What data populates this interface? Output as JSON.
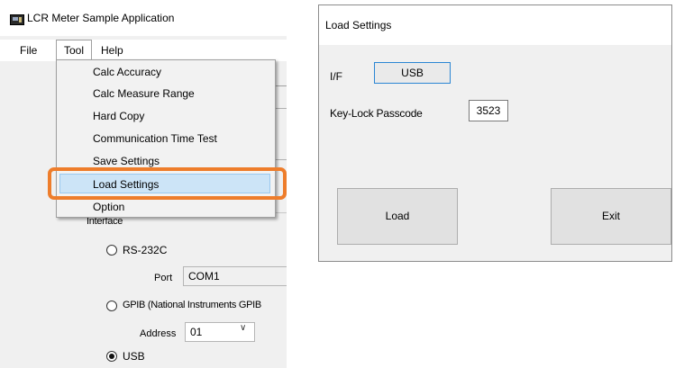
{
  "left_window": {
    "title": "LCR Meter Sample Application",
    "menu": {
      "file": "File",
      "tool": "Tool",
      "help": "Help"
    },
    "tool_menu_items": [
      "Calc Accuracy",
      "Calc Measure Range",
      "Hard Copy",
      "Communication Time Test",
      "Save Settings",
      "Load Settings",
      "Option"
    ],
    "highlighted_item": "Load Settings",
    "interface": {
      "group_label": "Interface",
      "rs232_label": "RS-232C",
      "port_label": "Port",
      "port_value": "COM1",
      "gpib_label": "GPIB (National Instruments GPIB",
      "address_label": "Address",
      "address_value": "01",
      "usb_label": "USB",
      "selected": "USB"
    }
  },
  "dialog": {
    "title": "Load Settings",
    "if_label": "I/F",
    "if_value": "USB",
    "keylock_label": "Key-Lock Passcode",
    "keylock_value": "3523",
    "load_label": "Load",
    "exit_label": "Exit"
  },
  "colors": {
    "callout": "#ee7d2b",
    "highlight": "#cce4f7",
    "focus_border": "#2b86d4"
  }
}
